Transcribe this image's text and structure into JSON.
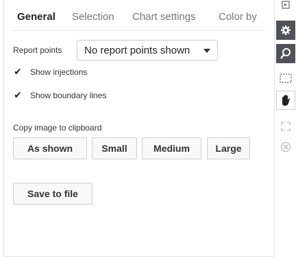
{
  "tabs": [
    {
      "label": "General"
    },
    {
      "label": "Selection"
    },
    {
      "label": "Chart settings"
    },
    {
      "label": "Color by"
    }
  ],
  "report_points": {
    "label": "Report points",
    "selected": "No report points shown"
  },
  "options": {
    "show_injections": {
      "label": "Show injections",
      "checked": true
    },
    "show_boundary_lines": {
      "label": "Show boundary lines",
      "checked": true
    }
  },
  "copy_section": {
    "label": "Copy image to clipboard",
    "buttons": [
      "As shown",
      "Small",
      "Medium",
      "Large"
    ]
  },
  "save_button": {
    "label": "Save to file"
  },
  "toolbar": {
    "icons": [
      "settings-icon",
      "zoom-icon",
      "marquee-select-icon",
      "pan-hand-icon",
      "fit-view-icon",
      "clear-icon"
    ]
  }
}
